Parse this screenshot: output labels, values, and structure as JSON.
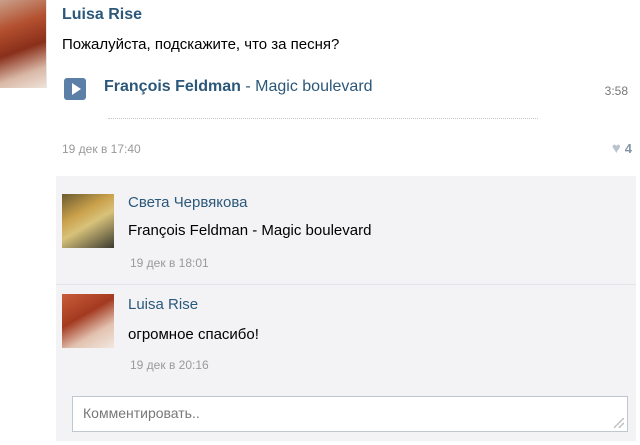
{
  "post": {
    "author": "Luisa Rise",
    "text": "Пожалуйста, подскажите, что за песня?",
    "audio": {
      "artist": "François Feldman",
      "separator": " - ",
      "track": "Magic boulevard",
      "duration": "3:58"
    },
    "date": "19 дек в 17:40",
    "likes": "4"
  },
  "replies": [
    {
      "author": "Света Червякова",
      "text": "François Feldman - Magic boulevard",
      "date": "19 дек в 18:01"
    },
    {
      "author": "Luisa Rise",
      "text": "огромное спасибо!",
      "date": "19 дек в 20:16"
    }
  ],
  "comment_box": {
    "placeholder": "Комментировать.."
  },
  "colors": {
    "link": "#2b587a",
    "muted": "#999999",
    "reply_background": "#f3f3f5"
  },
  "icons": {
    "play": "play-icon",
    "like": "heart-icon",
    "resize": "resize-grip-icon"
  }
}
